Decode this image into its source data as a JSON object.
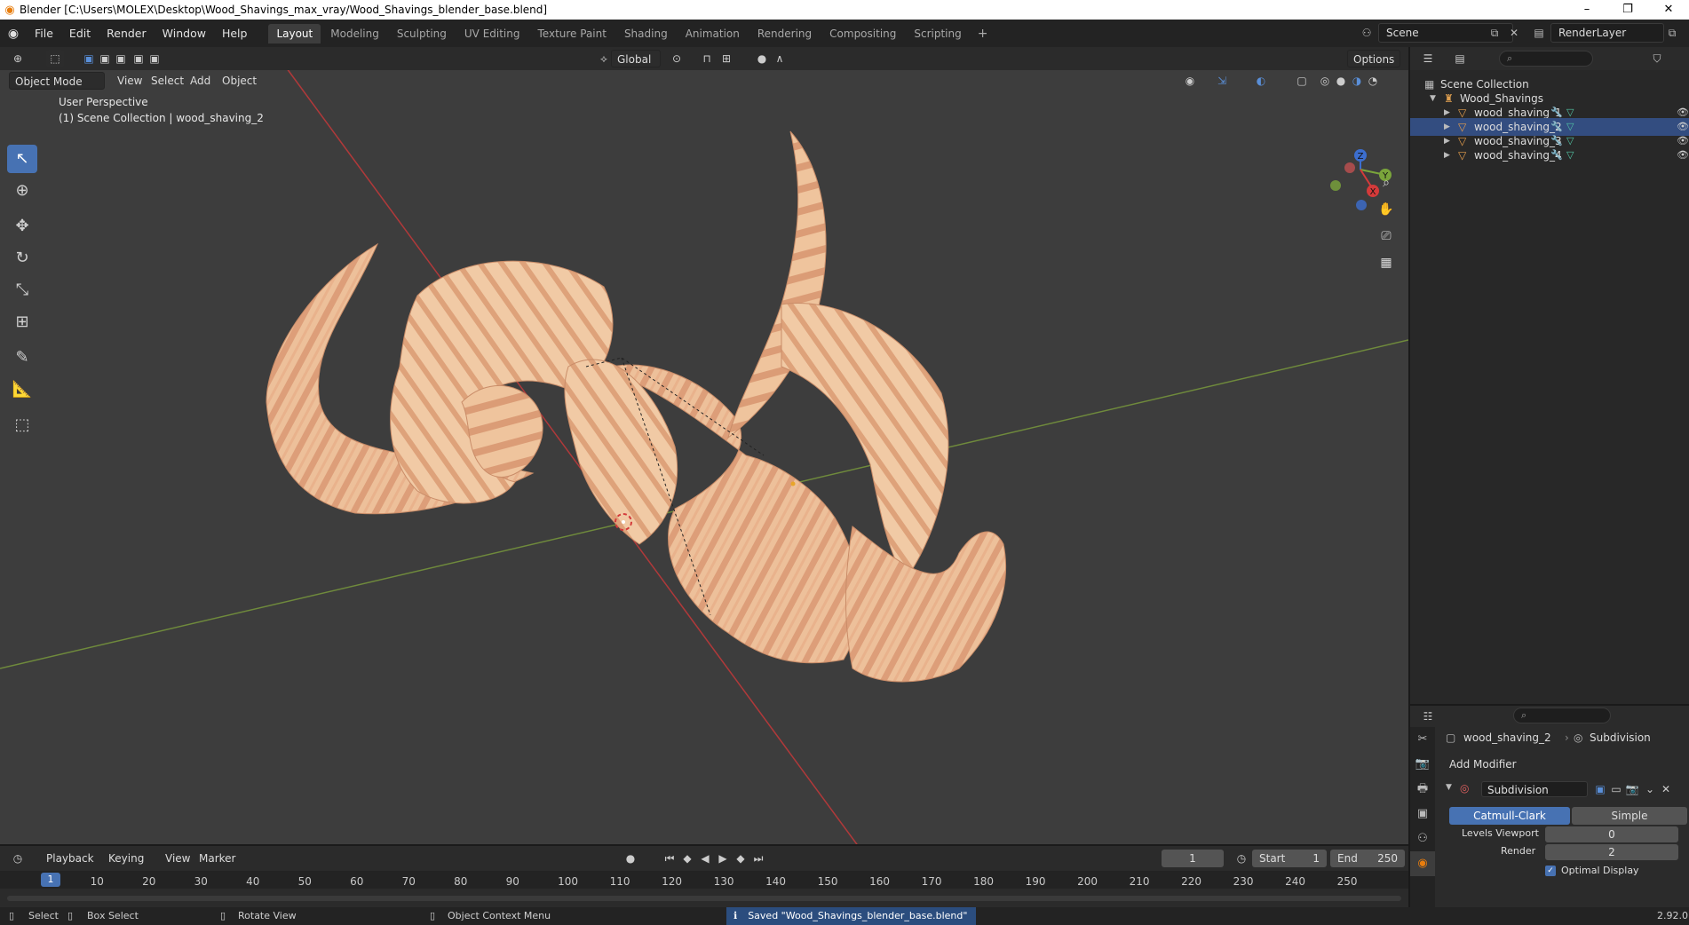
{
  "window": {
    "title": "Blender [C:\\Users\\MOLEX\\Desktop\\Wood_Shavings_max_vray/Wood_Shavings_blender_base.blend]",
    "minimize": "–",
    "maximize": "❐",
    "close": "✕"
  },
  "menu": [
    "File",
    "Edit",
    "Render",
    "Window",
    "Help"
  ],
  "workspaces": [
    "Layout",
    "Modeling",
    "Sculpting",
    "UV Editing",
    "Texture Paint",
    "Shading",
    "Animation",
    "Rendering",
    "Compositing",
    "Scripting"
  ],
  "active_workspace": "Layout",
  "scene": {
    "name": "Scene",
    "render_layer": "RenderLayer"
  },
  "viewport": {
    "mode": "Object Mode",
    "menus": [
      "View",
      "Select",
      "Add",
      "Object"
    ],
    "transform_orientation": "Global",
    "options_label": "Options",
    "perspective": "User Perspective",
    "collection_info": "(1) Scene Collection | wood_shaving_2",
    "gizmo_axes": {
      "z": "Z",
      "y": "Y",
      "x": "X"
    }
  },
  "outliner": {
    "root": "Scene Collection",
    "collection": "Wood_Shavings",
    "objects": [
      "wood_shaving_1",
      "wood_shaving_2",
      "wood_shaving_3",
      "wood_shaving_4"
    ]
  },
  "properties": {
    "object": "wood_shaving_2",
    "modifier_context": "Subdivision",
    "add_modifier": "Add Modifier",
    "modifier_name": "Subdivision",
    "subdiv_types": [
      "Catmull-Clark",
      "Simple"
    ],
    "active_subdiv_type": "Catmull-Clark",
    "levels_viewport_label": "Levels Viewport",
    "levels_viewport": "0",
    "render_label": "Render",
    "render_levels": "2",
    "optimal_display": "Optimal Display"
  },
  "timeline": {
    "menus": [
      "Playback",
      "Keying",
      "View",
      "Marker"
    ],
    "current_frame": "1",
    "start_label": "Start",
    "start": "1",
    "end_label": "End",
    "end": "250",
    "ticks": [
      "10",
      "20",
      "30",
      "40",
      "50",
      "60",
      "70",
      "80",
      "90",
      "100",
      "110",
      "120",
      "130",
      "140",
      "150",
      "160",
      "170",
      "180",
      "190",
      "200",
      "210",
      "220",
      "230",
      "240",
      "250"
    ],
    "playhead": "1"
  },
  "statusbar": {
    "select": "Select",
    "box_select": "Box Select",
    "rotate_view": "Rotate View",
    "context_menu": "Object Context Menu",
    "message": "Saved \"Wood_Shavings_blender_base.blend\"",
    "version": "2.92.0"
  },
  "colors": {
    "accent": "#4772b3",
    "blender_orange": "#e87d0d",
    "x_axis": "#cc3a3a",
    "y_axis": "#8ab83a",
    "wood": "#e6b48c"
  }
}
